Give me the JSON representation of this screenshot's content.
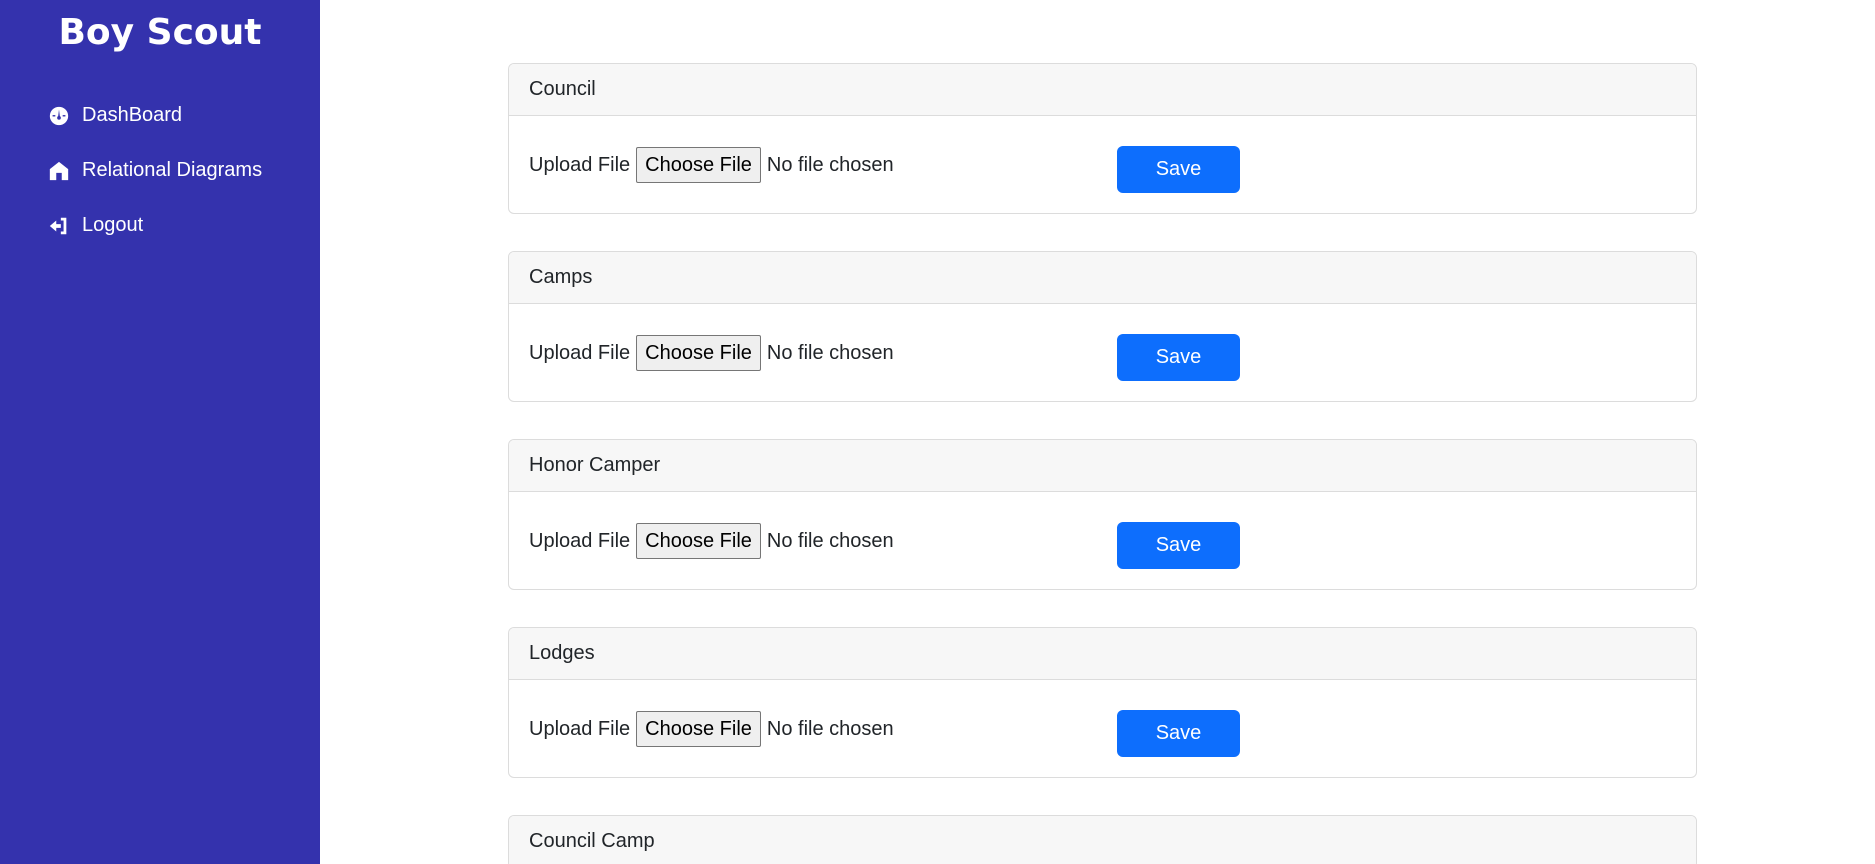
{
  "app": {
    "brand": "Boy Scout"
  },
  "sidebar": {
    "items": [
      {
        "label": "DashBoard",
        "icon": "dashboard-gauge-icon"
      },
      {
        "label": "Relational Diagrams",
        "icon": "tent-icon"
      },
      {
        "label": "Logout",
        "icon": "logout-icon"
      }
    ]
  },
  "colors": {
    "sidebar_bg": "#3432ad",
    "primary_button": "#0d6efd"
  },
  "upload_cards": [
    {
      "title": "Council",
      "upload_label": "Upload File",
      "choose_label": "Choose File",
      "file_status": "No file chosen",
      "save_label": "Save"
    },
    {
      "title": "Camps",
      "upload_label": "Upload File",
      "choose_label": "Choose File",
      "file_status": "No file chosen",
      "save_label": "Save"
    },
    {
      "title": "Honor Camper",
      "upload_label": "Upload File",
      "choose_label": "Choose File",
      "file_status": "No file chosen",
      "save_label": "Save"
    },
    {
      "title": "Lodges",
      "upload_label": "Upload File",
      "choose_label": "Choose File",
      "file_status": "No file chosen",
      "save_label": "Save"
    },
    {
      "title": "Council Camp"
    }
  ]
}
